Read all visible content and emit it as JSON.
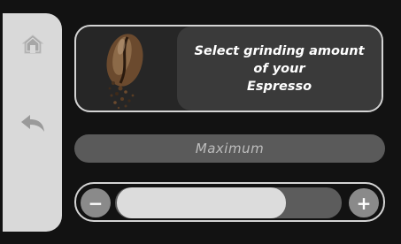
{
  "sidebar": {
    "home_icon": "home-icon",
    "back_icon": "back-arrow-icon"
  },
  "info_card": {
    "image": "coffee-bean-ground-image",
    "line1": "Select grinding amount",
    "line2": "of your",
    "line3": "Espresso"
  },
  "level": {
    "label": "Maximum"
  },
  "slider": {
    "minus_label": "−",
    "plus_label": "+",
    "value_fraction": 0.75
  },
  "colors": {
    "background": "#121212",
    "sidebar": "#d9d9d9",
    "panel": "#3a3a3a",
    "fill": "#dcdcdc",
    "button": "#8a8a8a"
  }
}
